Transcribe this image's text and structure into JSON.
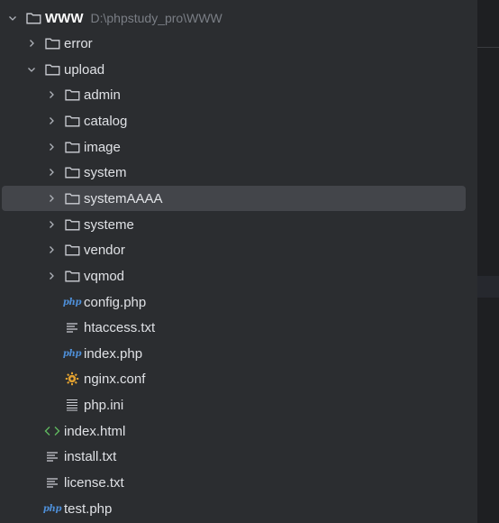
{
  "root": {
    "name": "WWW",
    "path": "D:\\phpstudy_pro\\WWW"
  },
  "items": [
    {
      "label": "error",
      "type": "folder",
      "expanded": false
    },
    {
      "label": "upload",
      "type": "folder",
      "expanded": true
    },
    {
      "label": "admin",
      "type": "folder",
      "expanded": false
    },
    {
      "label": "catalog",
      "type": "folder",
      "expanded": false
    },
    {
      "label": "image",
      "type": "folder",
      "expanded": false
    },
    {
      "label": "system",
      "type": "folder",
      "expanded": false
    },
    {
      "label": "systemAAAA",
      "type": "folder",
      "expanded": false,
      "selected": true
    },
    {
      "label": "systeme",
      "type": "folder",
      "expanded": false
    },
    {
      "label": "vendor",
      "type": "folder",
      "expanded": false
    },
    {
      "label": "vqmod",
      "type": "folder",
      "expanded": false
    },
    {
      "label": "config.php",
      "type": "php-file"
    },
    {
      "label": "htaccess.txt",
      "type": "text-file"
    },
    {
      "label": "index.php",
      "type": "php-file"
    },
    {
      "label": "nginx.conf",
      "type": "config-file"
    },
    {
      "label": "php.ini",
      "type": "ini-file"
    },
    {
      "label": "index.html",
      "type": "html-file"
    },
    {
      "label": "install.txt",
      "type": "text-file"
    },
    {
      "label": "license.txt",
      "type": "text-file"
    },
    {
      "label": "test.php",
      "type": "php-file"
    }
  ],
  "icons": {
    "php_badge": "php"
  },
  "colors": {
    "background": "#2b2d30",
    "selection": "#43454a",
    "text": "#dfe1e5",
    "path_text": "#7a7e85",
    "php_icon": "#4e8fd8",
    "html_icon": "#5fb85f",
    "config_icon": "#e0a030"
  }
}
